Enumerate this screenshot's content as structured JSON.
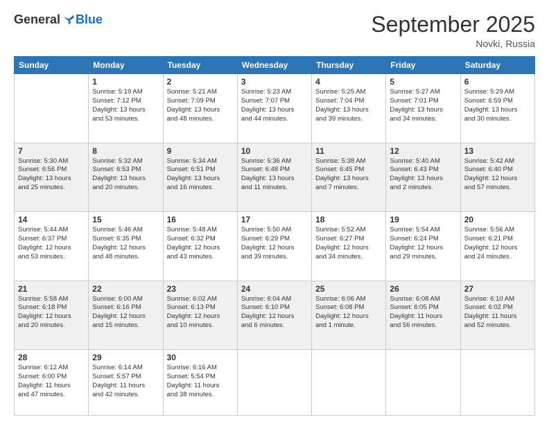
{
  "logo": {
    "general": "General",
    "blue": "Blue"
  },
  "title": "September 2025",
  "location": "Novki, Russia",
  "days_header": [
    "Sunday",
    "Monday",
    "Tuesday",
    "Wednesday",
    "Thursday",
    "Friday",
    "Saturday"
  ],
  "weeks": [
    {
      "shaded": false,
      "days": [
        {
          "num": "",
          "content": ""
        },
        {
          "num": "1",
          "content": "Sunrise: 5:19 AM\nSunset: 7:12 PM\nDaylight: 13 hours\nand 53 minutes."
        },
        {
          "num": "2",
          "content": "Sunrise: 5:21 AM\nSunset: 7:09 PM\nDaylight: 13 hours\nand 48 minutes."
        },
        {
          "num": "3",
          "content": "Sunrise: 5:23 AM\nSunset: 7:07 PM\nDaylight: 13 hours\nand 44 minutes."
        },
        {
          "num": "4",
          "content": "Sunrise: 5:25 AM\nSunset: 7:04 PM\nDaylight: 13 hours\nand 39 minutes."
        },
        {
          "num": "5",
          "content": "Sunrise: 5:27 AM\nSunset: 7:01 PM\nDaylight: 13 hours\nand 34 minutes."
        },
        {
          "num": "6",
          "content": "Sunrise: 5:29 AM\nSunset: 6:59 PM\nDaylight: 13 hours\nand 30 minutes."
        }
      ]
    },
    {
      "shaded": true,
      "days": [
        {
          "num": "7",
          "content": "Sunrise: 5:30 AM\nSunset: 6:56 PM\nDaylight: 13 hours\nand 25 minutes."
        },
        {
          "num": "8",
          "content": "Sunrise: 5:32 AM\nSunset: 6:53 PM\nDaylight: 13 hours\nand 20 minutes."
        },
        {
          "num": "9",
          "content": "Sunrise: 5:34 AM\nSunset: 6:51 PM\nDaylight: 13 hours\nand 16 minutes."
        },
        {
          "num": "10",
          "content": "Sunrise: 5:36 AM\nSunset: 6:48 PM\nDaylight: 13 hours\nand 11 minutes."
        },
        {
          "num": "11",
          "content": "Sunrise: 5:38 AM\nSunset: 6:45 PM\nDaylight: 13 hours\nand 7 minutes."
        },
        {
          "num": "12",
          "content": "Sunrise: 5:40 AM\nSunset: 6:43 PM\nDaylight: 13 hours\nand 2 minutes."
        },
        {
          "num": "13",
          "content": "Sunrise: 5:42 AM\nSunset: 6:40 PM\nDaylight: 12 hours\nand 57 minutes."
        }
      ]
    },
    {
      "shaded": false,
      "days": [
        {
          "num": "14",
          "content": "Sunrise: 5:44 AM\nSunset: 6:37 PM\nDaylight: 12 hours\nand 53 minutes."
        },
        {
          "num": "15",
          "content": "Sunrise: 5:46 AM\nSunset: 6:35 PM\nDaylight: 12 hours\nand 48 minutes."
        },
        {
          "num": "16",
          "content": "Sunrise: 5:48 AM\nSunset: 6:32 PM\nDaylight: 12 hours\nand 43 minutes."
        },
        {
          "num": "17",
          "content": "Sunrise: 5:50 AM\nSunset: 6:29 PM\nDaylight: 12 hours\nand 39 minutes."
        },
        {
          "num": "18",
          "content": "Sunrise: 5:52 AM\nSunset: 6:27 PM\nDaylight: 12 hours\nand 34 minutes."
        },
        {
          "num": "19",
          "content": "Sunrise: 5:54 AM\nSunset: 6:24 PM\nDaylight: 12 hours\nand 29 minutes."
        },
        {
          "num": "20",
          "content": "Sunrise: 5:56 AM\nSunset: 6:21 PM\nDaylight: 12 hours\nand 24 minutes."
        }
      ]
    },
    {
      "shaded": true,
      "days": [
        {
          "num": "21",
          "content": "Sunrise: 5:58 AM\nSunset: 6:18 PM\nDaylight: 12 hours\nand 20 minutes."
        },
        {
          "num": "22",
          "content": "Sunrise: 6:00 AM\nSunset: 6:16 PM\nDaylight: 12 hours\nand 15 minutes."
        },
        {
          "num": "23",
          "content": "Sunrise: 6:02 AM\nSunset: 6:13 PM\nDaylight: 12 hours\nand 10 minutes."
        },
        {
          "num": "24",
          "content": "Sunrise: 6:04 AM\nSunset: 6:10 PM\nDaylight: 12 hours\nand 6 minutes."
        },
        {
          "num": "25",
          "content": "Sunrise: 6:06 AM\nSunset: 6:08 PM\nDaylight: 12 hours\nand 1 minute."
        },
        {
          "num": "26",
          "content": "Sunrise: 6:08 AM\nSunset: 6:05 PM\nDaylight: 11 hours\nand 56 minutes."
        },
        {
          "num": "27",
          "content": "Sunrise: 6:10 AM\nSunset: 6:02 PM\nDaylight: 11 hours\nand 52 minutes."
        }
      ]
    },
    {
      "shaded": false,
      "days": [
        {
          "num": "28",
          "content": "Sunrise: 6:12 AM\nSunset: 6:00 PM\nDaylight: 11 hours\nand 47 minutes."
        },
        {
          "num": "29",
          "content": "Sunrise: 6:14 AM\nSunset: 5:57 PM\nDaylight: 11 hours\nand 42 minutes."
        },
        {
          "num": "30",
          "content": "Sunrise: 6:16 AM\nSunset: 5:54 PM\nDaylight: 11 hours\nand 38 minutes."
        },
        {
          "num": "",
          "content": ""
        },
        {
          "num": "",
          "content": ""
        },
        {
          "num": "",
          "content": ""
        },
        {
          "num": "",
          "content": ""
        }
      ]
    }
  ]
}
